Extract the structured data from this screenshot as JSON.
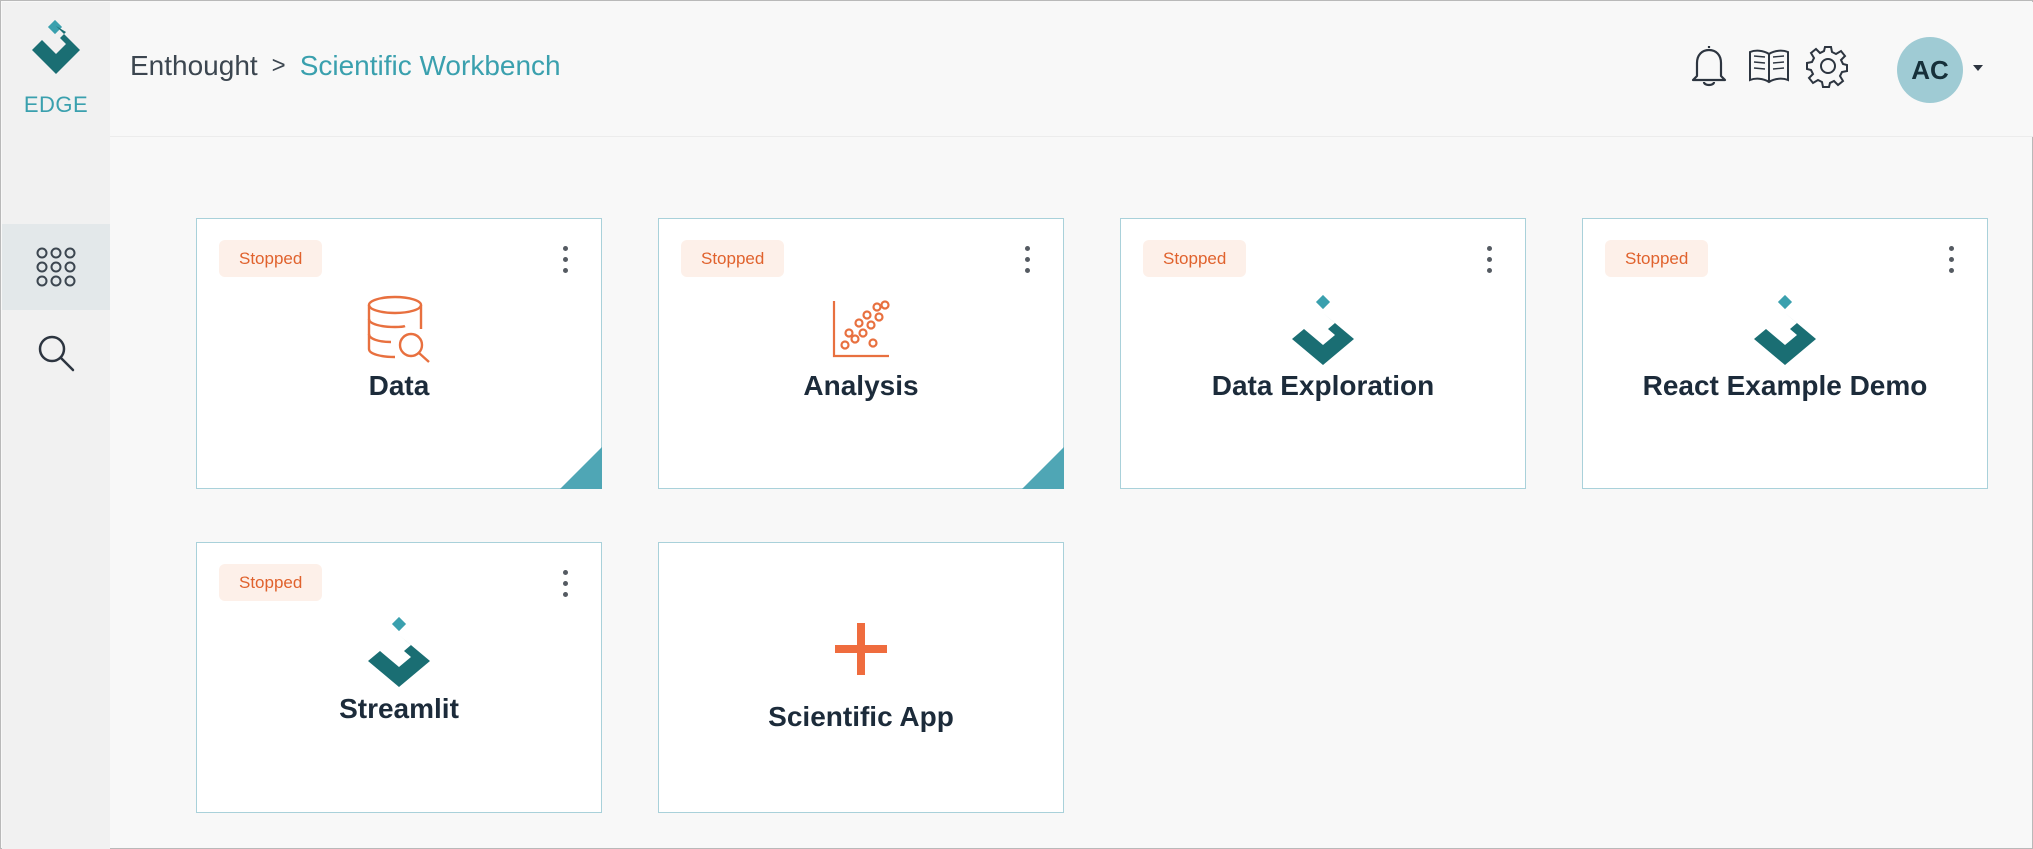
{
  "app": {
    "logo_text": "EDGE",
    "brand_color": "#1a6e73",
    "accent_color": "#3aa0ae",
    "status_color": "#e0622d"
  },
  "breadcrumb": {
    "root": "Enthought",
    "separator": ">",
    "current": "Scientific Workbench"
  },
  "header": {
    "icons": [
      "bell-icon",
      "book-icon",
      "gear-icon"
    ],
    "avatar_initials": "AC"
  },
  "sidebar": {
    "items": [
      {
        "name": "apps-grid-icon",
        "active": true
      },
      {
        "name": "search-icon",
        "active": false
      }
    ]
  },
  "cards": [
    {
      "title": "Data",
      "status": "Stopped",
      "icon": "database-search-icon",
      "corner_marker": true
    },
    {
      "title": "Analysis",
      "status": "Stopped",
      "icon": "scatter-plot-icon",
      "corner_marker": true
    },
    {
      "title": "Data Exploration",
      "status": "Stopped",
      "icon": "edge-logo-icon",
      "corner_marker": false
    },
    {
      "title": "React Example Demo",
      "status": "Stopped",
      "icon": "edge-logo-icon",
      "corner_marker": false
    },
    {
      "title": "Streamlit",
      "status": "Stopped",
      "icon": "edge-logo-icon",
      "corner_marker": false
    },
    {
      "title": "Scientific App",
      "status": "",
      "icon": "plus-icon",
      "corner_marker": false
    }
  ]
}
